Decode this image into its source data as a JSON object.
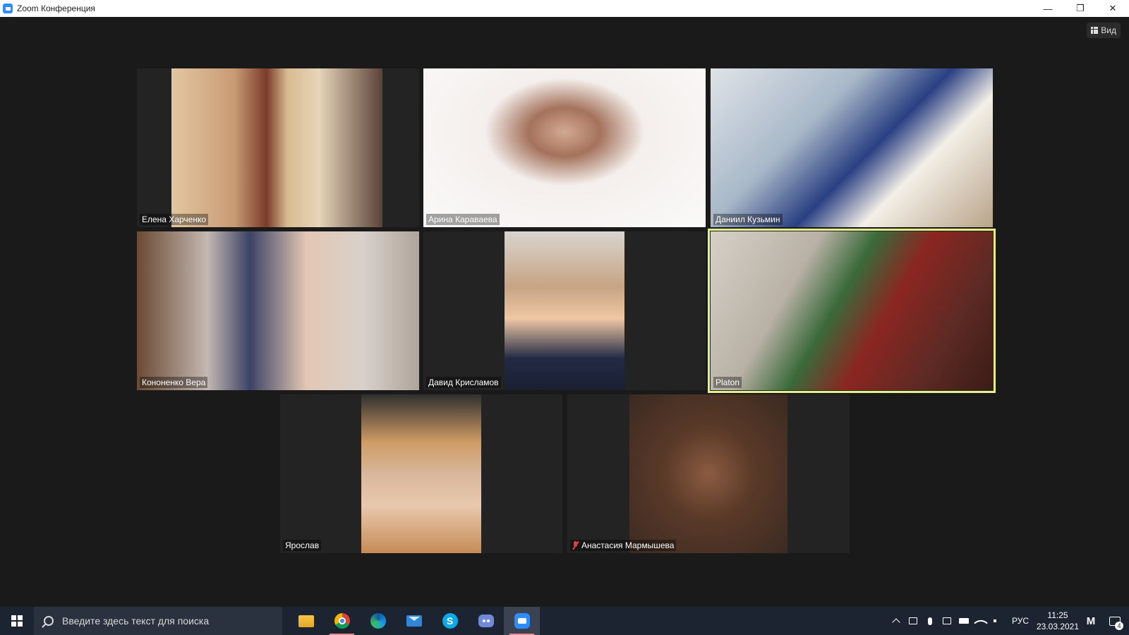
{
  "window": {
    "title": "Zoom Конференция",
    "minimize": "—",
    "maximize": "❐",
    "close": "✕"
  },
  "view_button": {
    "label": "Вид"
  },
  "participants": [
    {
      "name": "Елена Харченко",
      "muted": false,
      "active": false
    },
    {
      "name": "Арина Караваева",
      "muted": false,
      "active": false
    },
    {
      "name": "Даниил Кузьмин",
      "muted": false,
      "active": false
    },
    {
      "name": "Кононенко Вера",
      "muted": false,
      "active": false
    },
    {
      "name": "Давид Крисламов",
      "muted": false,
      "active": false
    },
    {
      "name": "Platon",
      "muted": false,
      "active": true
    },
    {
      "name": "Ярослав",
      "muted": false,
      "active": false
    },
    {
      "name": "Анастасия Мармышева",
      "muted": true,
      "active": false
    }
  ],
  "taskbar": {
    "search_placeholder": "Введите здесь текст для поиска",
    "apps": [
      "file-explorer",
      "chrome",
      "edge",
      "mail",
      "skype",
      "discord",
      "zoom"
    ],
    "skype_letter": "S",
    "language": "РУС",
    "time": "11:25",
    "date": "23.03.2021",
    "notification_count": "4",
    "m_logo": "M"
  },
  "colors": {
    "active_speaker_border": "#e4f18a",
    "background": "#1a1a1a",
    "taskbar": "#1c2431",
    "zoom_blue": "#2d8cff"
  }
}
